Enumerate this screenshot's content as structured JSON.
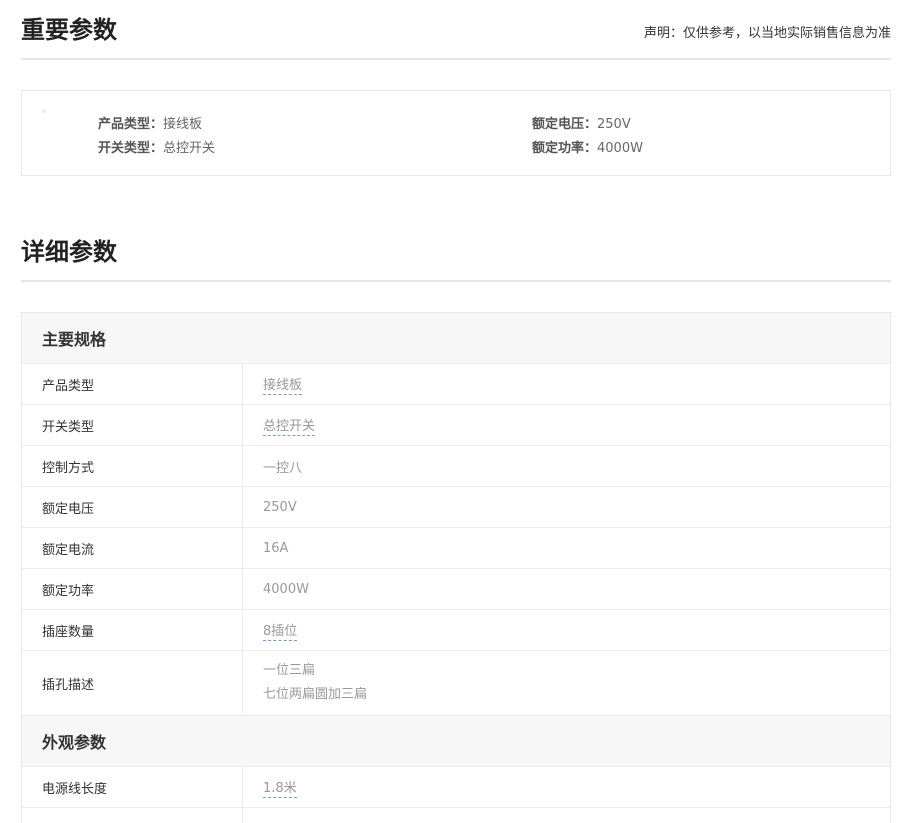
{
  "important": {
    "title": "重要参数",
    "disclaimer": "声明：仅供参考，以当地实际销售信息为准",
    "params": [
      {
        "key": "产品类型：",
        "value": "接线板"
      },
      {
        "key": "开关类型：",
        "value": "总控开关"
      },
      {
        "key": "额定电压：",
        "value": "250V"
      },
      {
        "key": "额定功率：",
        "value": "4000W"
      }
    ]
  },
  "detail": {
    "title": "详细参数",
    "groups": [
      {
        "name": "主要规格",
        "rows": [
          {
            "label": "产品类型",
            "value": "接线板",
            "link": true
          },
          {
            "label": "开关类型",
            "value": "总控开关",
            "link": true
          },
          {
            "label": "控制方式",
            "value": "一控八",
            "link": false
          },
          {
            "label": "额定电压",
            "value": "250V",
            "link": false
          },
          {
            "label": "额定电流",
            "value": "16A",
            "link": false
          },
          {
            "label": "额定功率",
            "value": "4000W",
            "link": false
          },
          {
            "label": "插座数量",
            "value": "8插位",
            "link": true
          },
          {
            "label": "插孔描述",
            "values": [
              "一位三扁",
              "七位两扁圆加三扁"
            ],
            "link": false
          }
        ]
      },
      {
        "name": "外观参数",
        "rows": [
          {
            "label": "电源线长度",
            "value": "1.8米",
            "link": true
          }
        ]
      }
    ]
  }
}
